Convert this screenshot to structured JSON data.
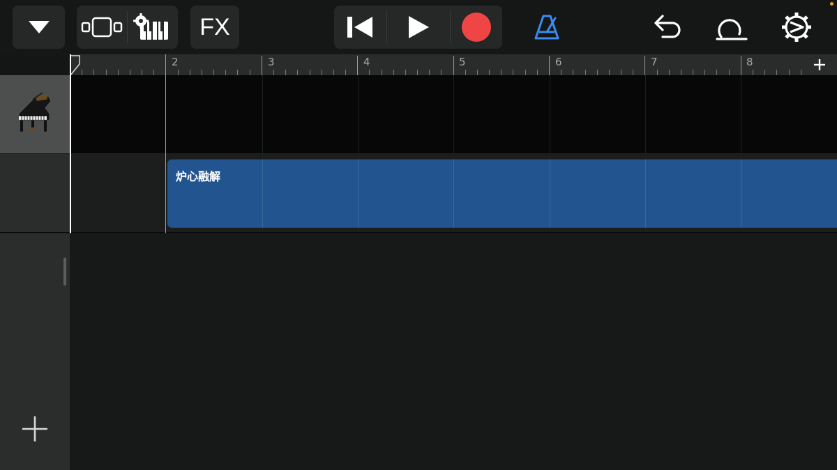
{
  "toolbar": {
    "fx_label": "FX",
    "record_color": "#f04545",
    "metronome_color": "#3b8cf2",
    "icons": [
      "track-menu-icon",
      "track-view-icon",
      "smart-controls-icon",
      "rewind-icon",
      "play-icon",
      "record-icon",
      "metronome-icon",
      "undo-icon",
      "loop-icon",
      "settings-icon"
    ]
  },
  "ruler": {
    "bars": [
      "2",
      "3",
      "4",
      "5",
      "6",
      "7",
      "8"
    ]
  },
  "tracks": [
    {
      "instrument": "grand-piano",
      "region_name": "炉心融解",
      "region_color": "#225590"
    }
  ],
  "sidebar": {
    "add_track_icon": "plus-icon"
  }
}
